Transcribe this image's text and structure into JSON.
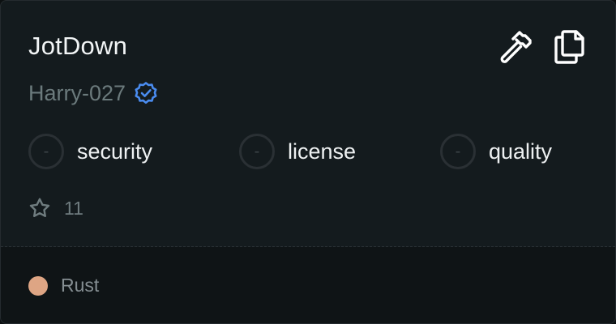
{
  "repo": {
    "name": "JotDown",
    "owner": "Harry-027",
    "verified_icon": "verified-badge-icon",
    "stars": "11"
  },
  "actions": {
    "build_icon": "hammer-icon",
    "copy_icon": "copy-icon"
  },
  "checks": [
    {
      "status": "-",
      "label": "security"
    },
    {
      "status": "-",
      "label": "license"
    },
    {
      "status": "-",
      "label": "quality"
    }
  ],
  "language": {
    "name": "Rust",
    "color": "#dea584"
  },
  "colors": {
    "verified": "#4a8cf0",
    "card_bg": "#141b1e",
    "footer_bg": "#0f1416"
  }
}
